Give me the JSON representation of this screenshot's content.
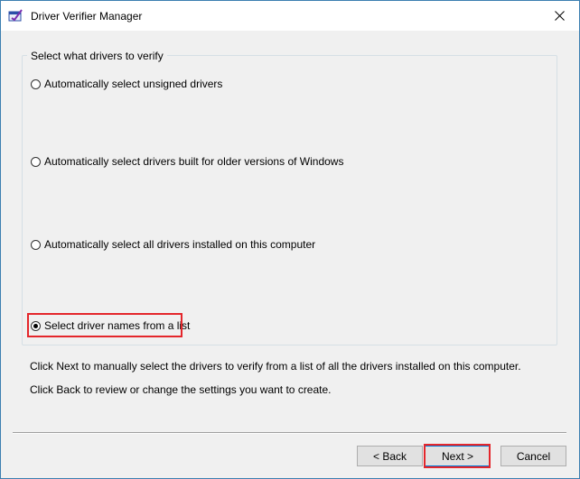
{
  "window": {
    "title": "Driver Verifier Manager"
  },
  "group": {
    "legend": "Select what drivers to verify",
    "options": [
      {
        "label": "Automatically select unsigned drivers",
        "checked": false
      },
      {
        "label": "Automatically select drivers built for older versions of Windows",
        "checked": false
      },
      {
        "label": "Automatically select all drivers installed on this computer",
        "checked": false
      },
      {
        "label": "Select driver names from a list",
        "checked": true
      }
    ]
  },
  "descriptions": {
    "next_hint": "Click Next to manually select the drivers to verify from a list of all the drivers installed on this computer.",
    "back_hint": "Click Back to review or change the settings you want to create."
  },
  "buttons": {
    "back": "< Back",
    "next": "Next >",
    "cancel": "Cancel"
  },
  "colors": {
    "highlight": "#e4262b",
    "window_border": "#3c7fb1"
  }
}
